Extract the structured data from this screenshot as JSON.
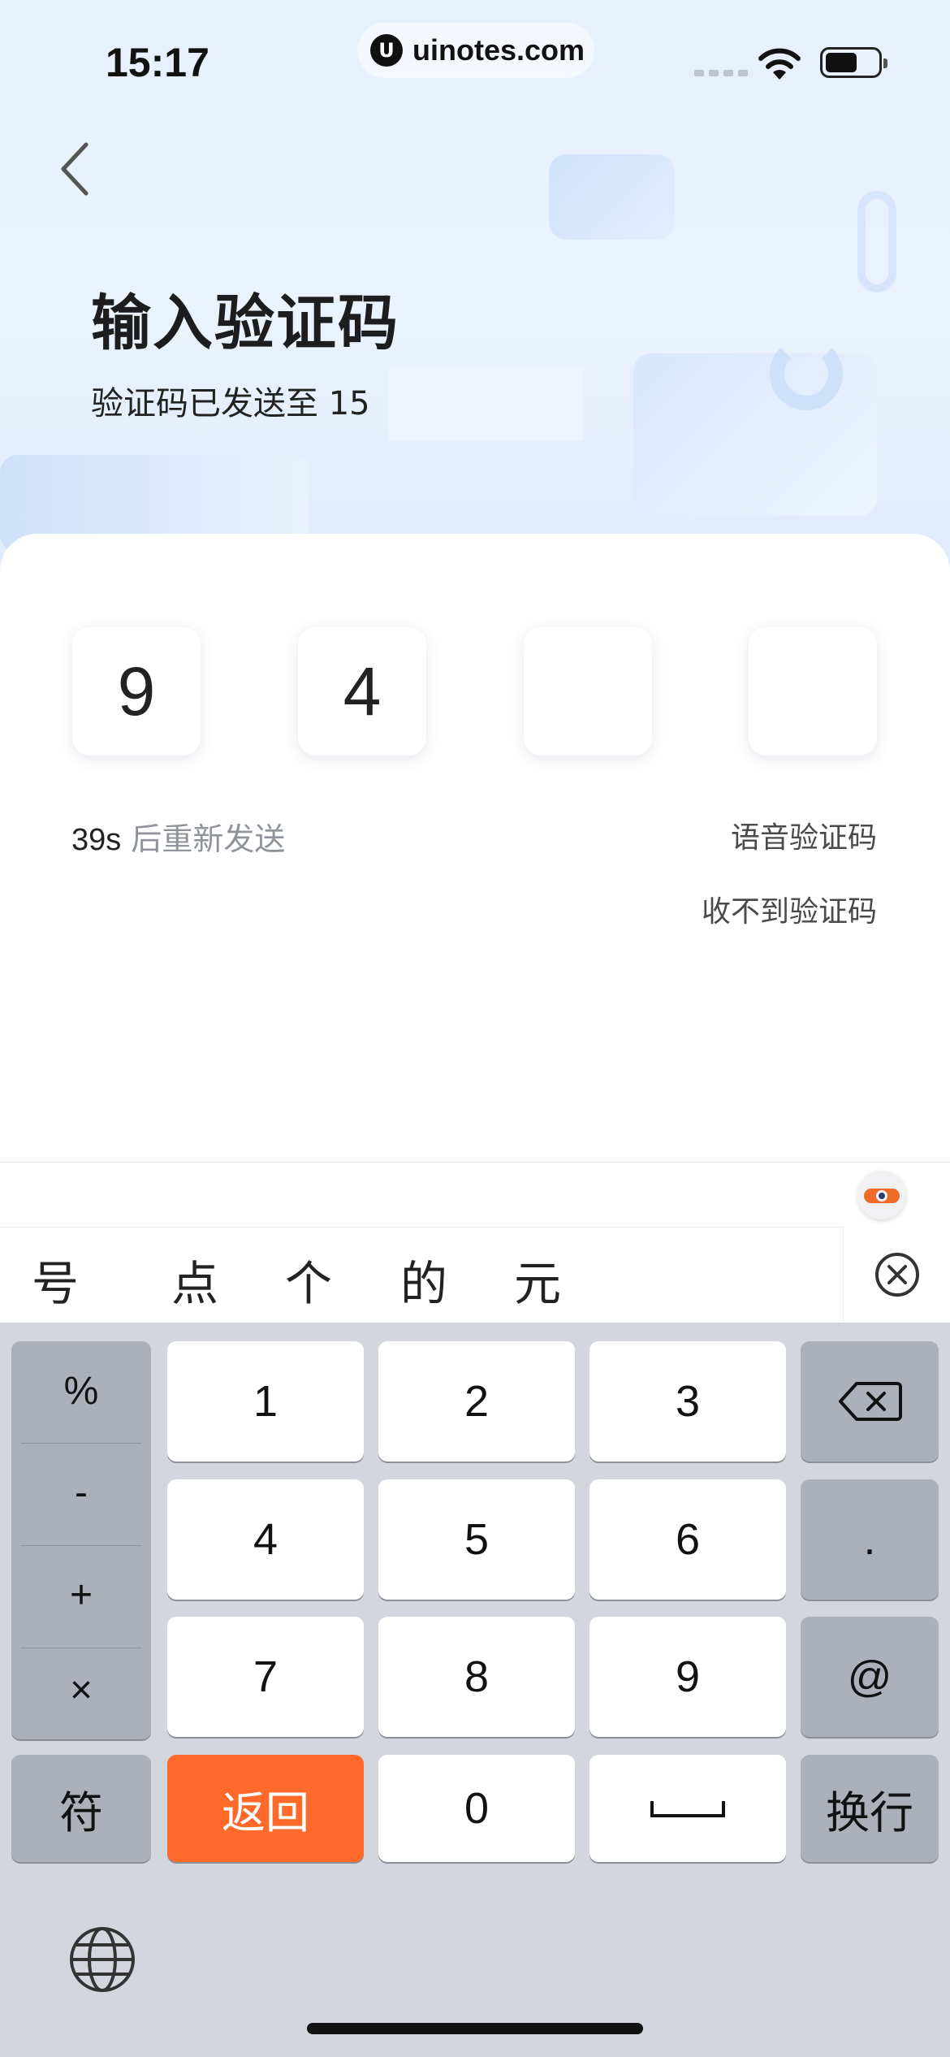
{
  "status_bar": {
    "time": "15:17",
    "site": "uinotes.com",
    "logo_letter": "U",
    "icons": [
      "signal-icon",
      "wifi-icon",
      "battery-icon"
    ]
  },
  "header": {
    "back_icon": "chevron-left-icon",
    "title": "输入验证码",
    "subtitle": "验证码已发送至 15"
  },
  "code": {
    "digits": [
      "9",
      "4",
      "",
      ""
    ]
  },
  "links": {
    "countdown": "39s",
    "resend_text": "后重新发送",
    "voice_code": "语音验证码",
    "no_code": "收不到验证码"
  },
  "candidates": {
    "items": [
      "号",
      "点",
      "个",
      "的",
      "元"
    ],
    "close_icon": "close-circle-icon"
  },
  "keyboard": {
    "symbols": [
      "%",
      "-",
      "+",
      "×"
    ],
    "row1": [
      "1",
      "2",
      "3"
    ],
    "row2": [
      "4",
      "5",
      "6"
    ],
    "row3": [
      "7",
      "8",
      "9"
    ],
    "dot": ".",
    "at": "@",
    "fu": "符",
    "back": "返回",
    "zero": "0",
    "newline": "换行",
    "backspace_icon": "backspace-icon",
    "space_icon": "space-icon",
    "globe_icon": "globe-icon",
    "accent_color": "#ff6a2b"
  }
}
